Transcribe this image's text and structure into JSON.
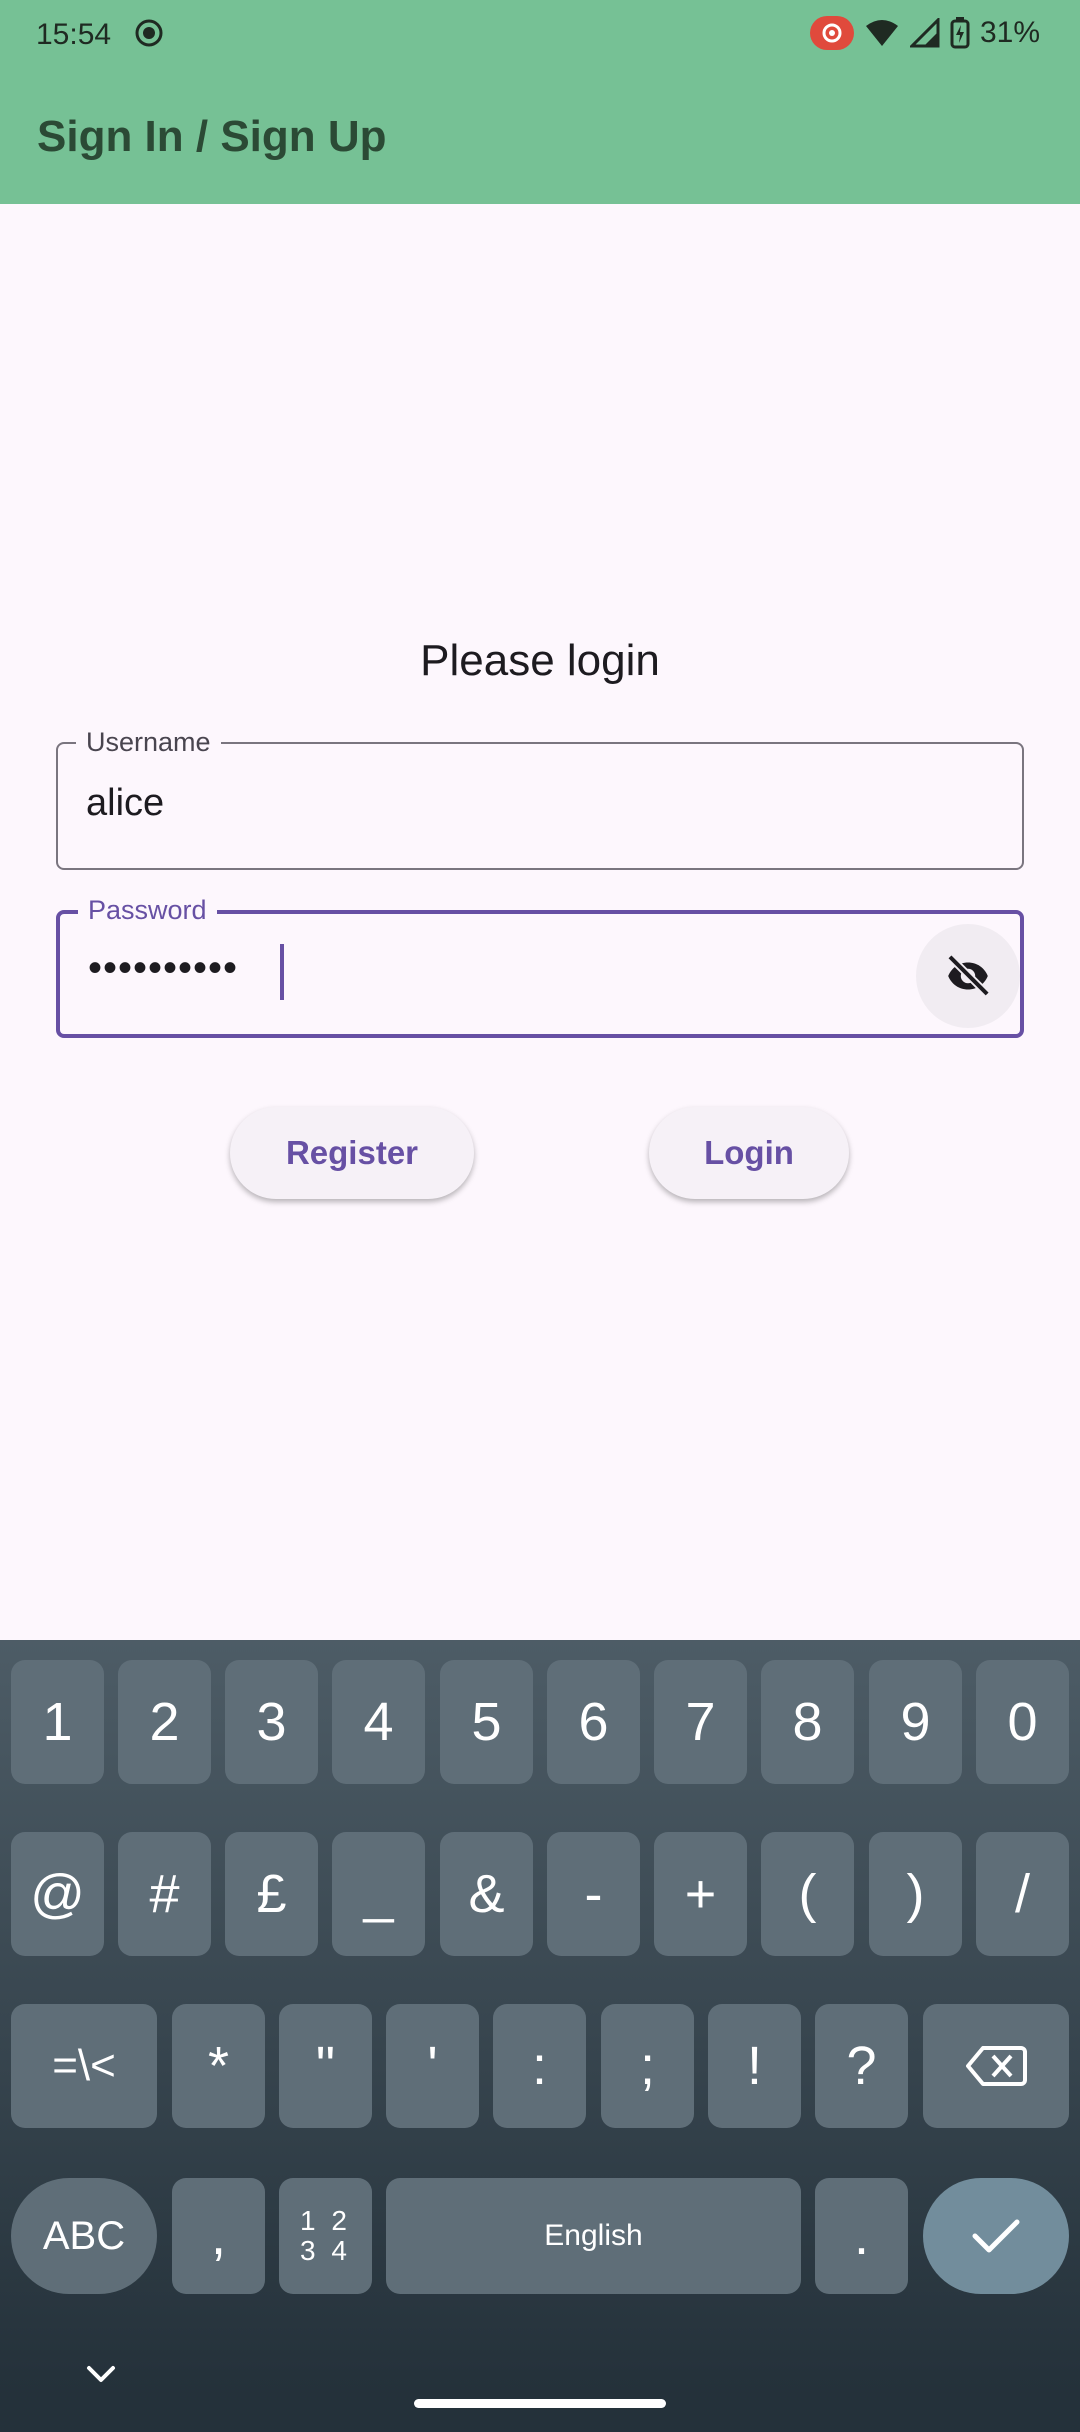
{
  "status_bar": {
    "time": "15:54",
    "battery": "31%"
  },
  "app_bar": {
    "title": "Sign In / Sign Up"
  },
  "form": {
    "heading": "Please login",
    "username": {
      "label": "Username",
      "value": "alice"
    },
    "password": {
      "label": "Password",
      "value": "••••••••••"
    },
    "register_label": "Register",
    "login_label": "Login"
  },
  "keyboard": {
    "row1": [
      "1",
      "2",
      "3",
      "4",
      "5",
      "6",
      "7",
      "8",
      "9",
      "0"
    ],
    "row2": [
      "@",
      "#",
      "£",
      "_",
      "&",
      "-",
      "+",
      "(",
      ")",
      "/"
    ],
    "row3": [
      "=\\<",
      "*",
      "\"",
      "'",
      ":",
      ";",
      "!",
      "?"
    ],
    "abc": "ABC",
    "comma": ",",
    "numsym_top": "1 2",
    "numsym_bottom": "3 4",
    "space": "English",
    "period": "."
  },
  "colors": {
    "app_bar": "#76c195",
    "accent": "#6750a4",
    "background": "#fdf7fd",
    "keyboard_key": "#5f6e78",
    "enter_key": "#728d9c"
  }
}
